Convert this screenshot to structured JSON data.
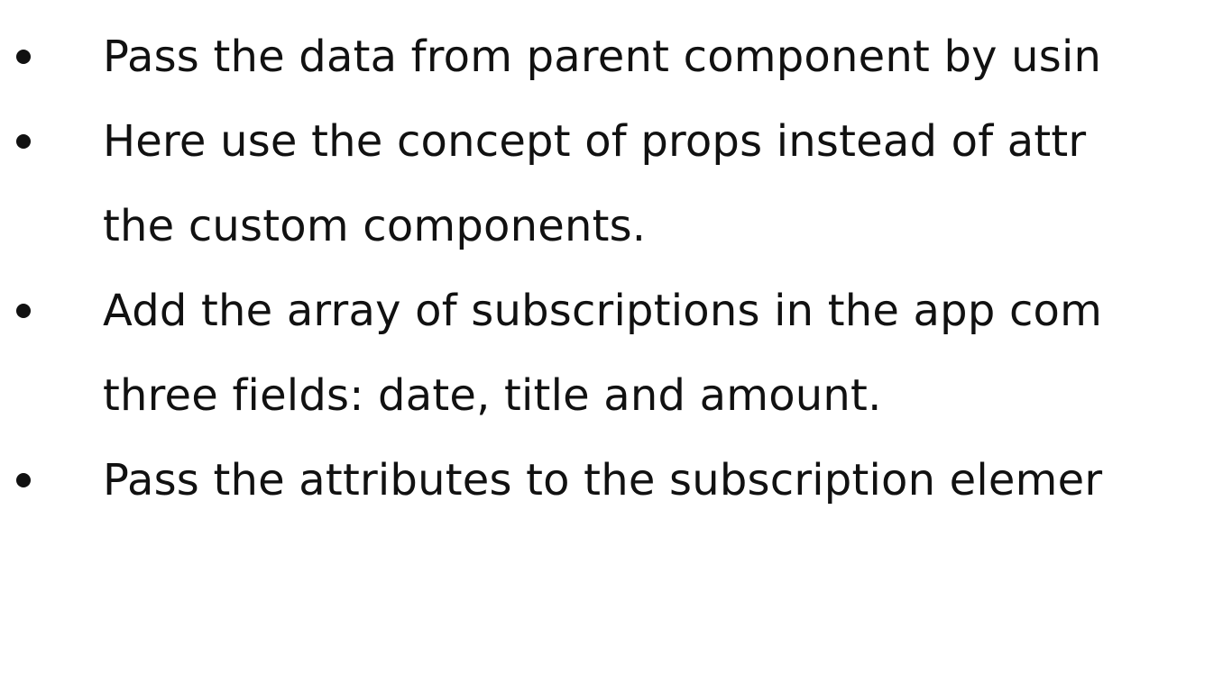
{
  "slide": {
    "bullets": [
      {
        "lines": [
          "Pass the data from parent component by usin"
        ]
      },
      {
        "lines": [
          "Here  use the concept of props instead of attr",
          "the custom components."
        ]
      },
      {
        "lines": [
          "Add the array of subscriptions in the app com",
          "three fields: date, title and amount."
        ]
      },
      {
        "lines": [
          "Pass the attributes to the subscription elemer"
        ]
      }
    ]
  },
  "colors": {
    "text": "#111111",
    "background": "#ffffff"
  }
}
